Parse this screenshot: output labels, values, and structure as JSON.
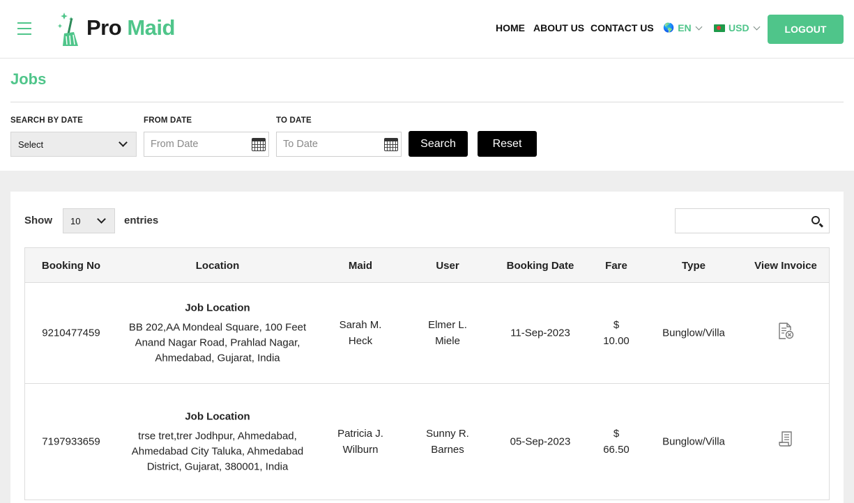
{
  "header": {
    "logo_pro": "Pro",
    "logo_maid": "Maid",
    "nav": [
      "HOME",
      "ABOUT US",
      "CONTACT US"
    ],
    "language": {
      "flag": "🌎",
      "label": "EN"
    },
    "currency": {
      "label": "USD"
    },
    "logout_label": "LOGOUT",
    "accent_color": "#4fc58a"
  },
  "page": {
    "title": "Jobs"
  },
  "filters": {
    "search_by_date_label": "SEARCH BY DATE",
    "search_by_date_value": "Select",
    "from_date_label": "FROM DATE",
    "from_date_placeholder": "From Date",
    "to_date_label": "TO DATE",
    "to_date_placeholder": "To Date",
    "search_label": "Search",
    "reset_label": "Reset"
  },
  "table_controls": {
    "show_label": "Show",
    "entries_value": "10",
    "entries_label": "entries",
    "search_value": ""
  },
  "table": {
    "columns": [
      "Booking No",
      "Location",
      "Maid",
      "User",
      "Booking Date",
      "Fare",
      "Type",
      "View Invoice"
    ],
    "rows": [
      {
        "booking_no": "9210477459",
        "location_title": "Job Location",
        "location_address": "BB 202,AA Mondeal Square, 100 Feet Anand Nagar Road, Prahlad Nagar, Ahmedabad, Gujarat, India",
        "maid": "Sarah M. Heck",
        "user": "Elmer L. Miele",
        "booking_date": "11-Sep-2023",
        "fare": "$ 10.00",
        "type": "Bunglow/Villa",
        "invoice_icon": "invoice-cancelled-icon"
      },
      {
        "booking_no": "7197933659",
        "location_title": "Job Location",
        "location_address": "trse tret,trer Jodhpur, Ahmedabad, Ahmedabad City Taluka, Ahmedabad District, Gujarat, 380001, India",
        "maid": "Patricia J. Wilburn",
        "user": "Sunny R. Barnes",
        "booking_date": "05-Sep-2023",
        "fare": "$ 66.50",
        "type": "Bunglow/Villa",
        "invoice_icon": "invoice-icon"
      }
    ]
  }
}
